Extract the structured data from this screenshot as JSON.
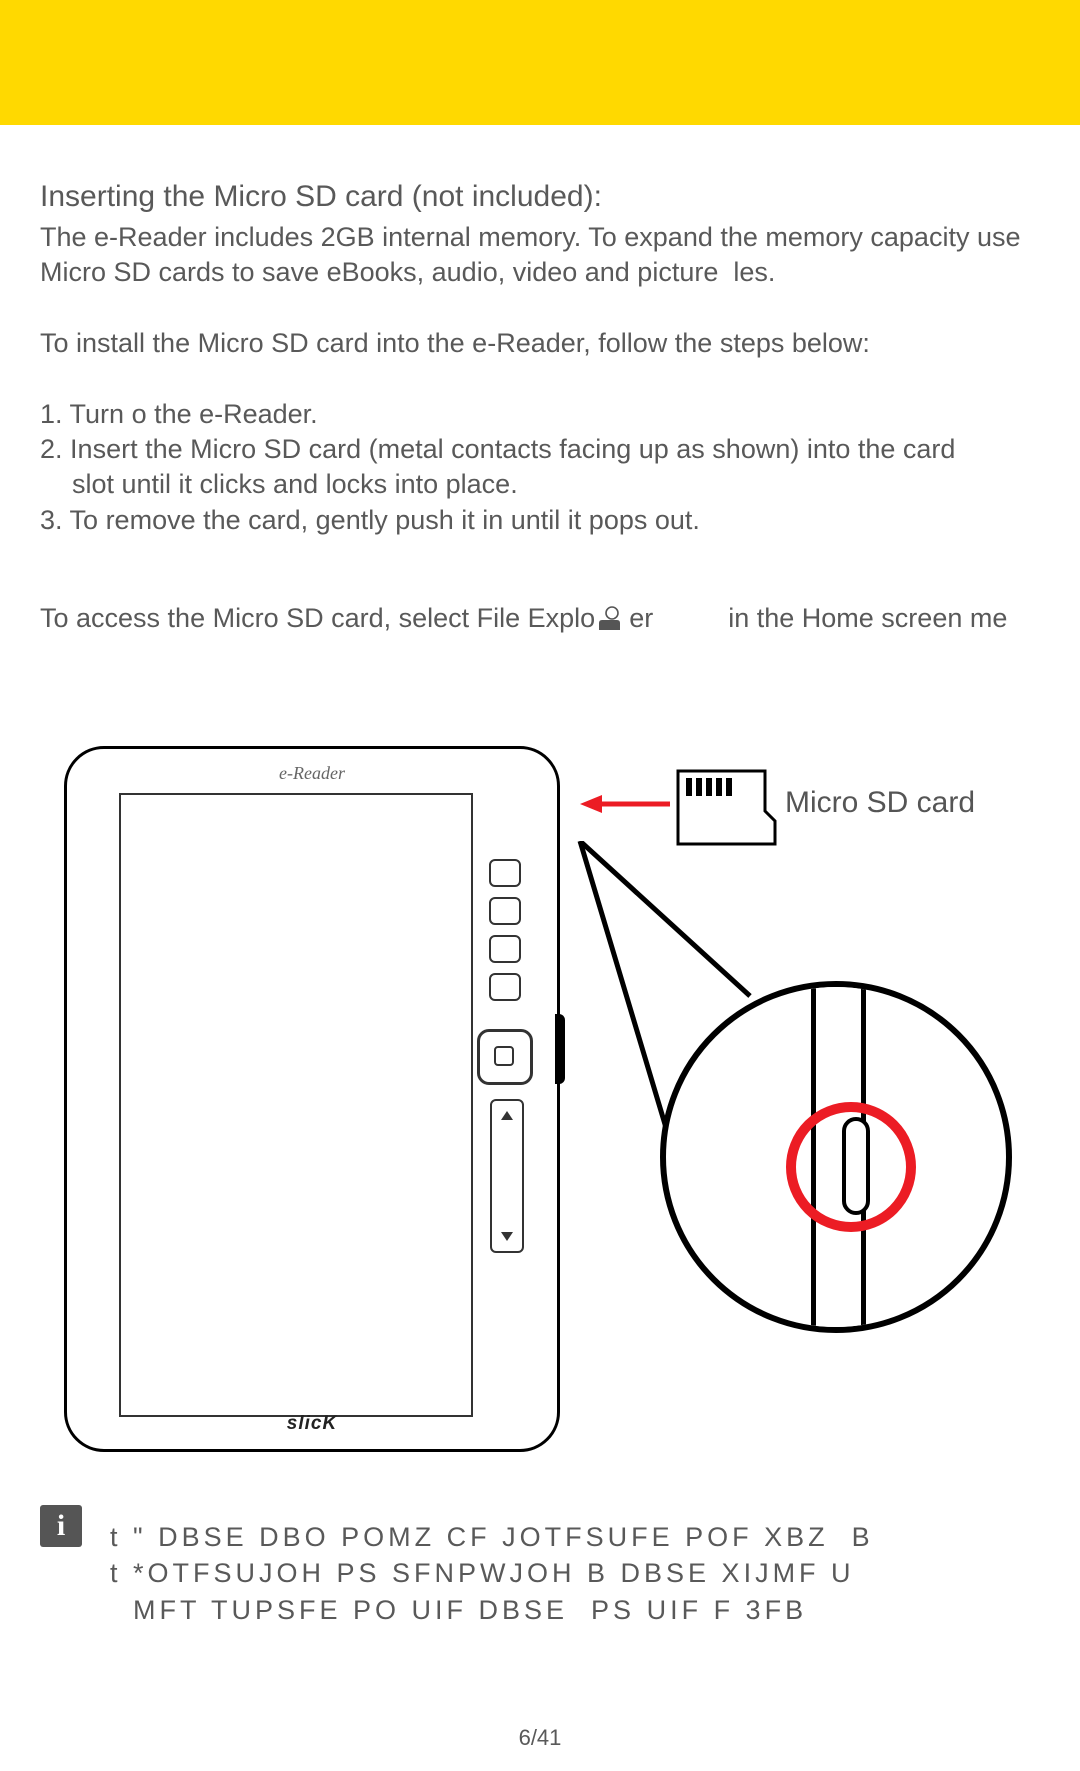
{
  "heading": "Inserting the Micro SD card (not included):",
  "intro": "The e-Reader includes 2GB internal memory. To expand the memory capacity use Micro SD cards to save eBooks, audio, video and picture  les.",
  "install_intro": "To install the Micro SD card into the e-Reader, follow the steps below:",
  "steps": [
    {
      "num": "1.",
      "text_a": "Turn o  the e-Reader.",
      "text_b": ""
    },
    {
      "num": "2.",
      "text_a": "Insert the Micro SD card (metal contacts facing up as shown) into the card",
      "text_b": "slot until it clicks and locks into place."
    },
    {
      "num": "3.",
      "text_a": "To remove the card, gently push it in until it pops out.",
      "text_b": ""
    }
  ],
  "access": {
    "before": "To access the Micro SD card, select  File Explo",
    "mid": "er",
    "after": "in the Home screen me"
  },
  "diagram": {
    "device_top_label": "e-Reader",
    "device_brand": "slicK",
    "sd_label": "Micro SD card"
  },
  "notes": {
    "icon_char": "i",
    "line1": "t \" DBSE DBO POMZ CF JOTFSUFE POF XBZ  B",
    "line2": "t *OTFSUJOH PS SFNPWJOH B DBSE XIJMF U",
    "line3": "  MFT TUPSFE PO UIF DBSE  PS UIF F 3FB"
  },
  "page_number": "6/41",
  "colors": {
    "top_bar": "#ffd900",
    "highlight_ring": "#ec1c24",
    "arrow": "#ec1c24"
  }
}
